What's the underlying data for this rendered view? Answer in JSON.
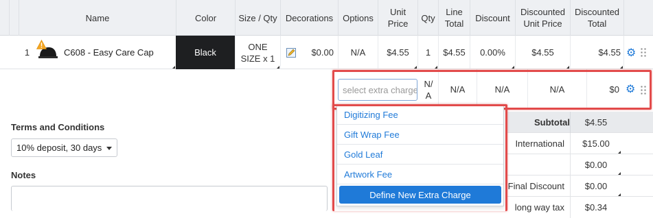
{
  "table": {
    "headers": {
      "name": "Name",
      "color": "Color",
      "size_qty": "Size / Qty",
      "decorations": "Decorations",
      "options": "Options",
      "unit_price": "Unit Price",
      "qty": "Qty",
      "line_total": "Line Total",
      "discount": "Discount",
      "discounted_unit_price": "Discounted Unit Price",
      "discounted_total": "Discounted Total"
    },
    "row": {
      "index": "1",
      "name": "C608 - Easy Care Cap",
      "color": "Black",
      "size_line1": "ONE",
      "size_line2": "SIZE x 1",
      "decorations_price": "$0.00",
      "options": "N/A",
      "unit_price": "$4.55",
      "qty": "1",
      "line_total": "$4.55",
      "discount": "0.00%",
      "discounted_unit_price": "$4.55",
      "discounted_total": "$4.55"
    },
    "extra_row": {
      "placeholder": "select extra charge",
      "qty_line1": "N/",
      "qty_line2": "A",
      "line_total": "N/A",
      "discount": "N/A",
      "discounted_unit_price": "N/A",
      "discounted_total": "$0"
    }
  },
  "dropdown": {
    "items": [
      "Digitizing Fee",
      "Gift Wrap Fee",
      "Gold Leaf",
      "Artwork Fee"
    ],
    "define_button": "Define New Extra Charge"
  },
  "terms": {
    "label": "Terms and Conditions",
    "selected": "10% deposit, 30 days"
  },
  "notes": {
    "label": "Notes"
  },
  "summary": {
    "subtotal_label": "Subtotal",
    "subtotal_value": "$4.55",
    "international_label": "International",
    "international_value": "$15.00",
    "blank_value": "$0.00",
    "final_discount_label": "Final Discount",
    "final_discount_value": "$0.00",
    "tax_label": "long way tax",
    "tax_value": "$0.34"
  },
  "colors": {
    "accent": "#1f7ad8",
    "highlight": "#e24b4b",
    "color_swatch": "#1e1f21",
    "summary_bg": "#e8eaed"
  }
}
